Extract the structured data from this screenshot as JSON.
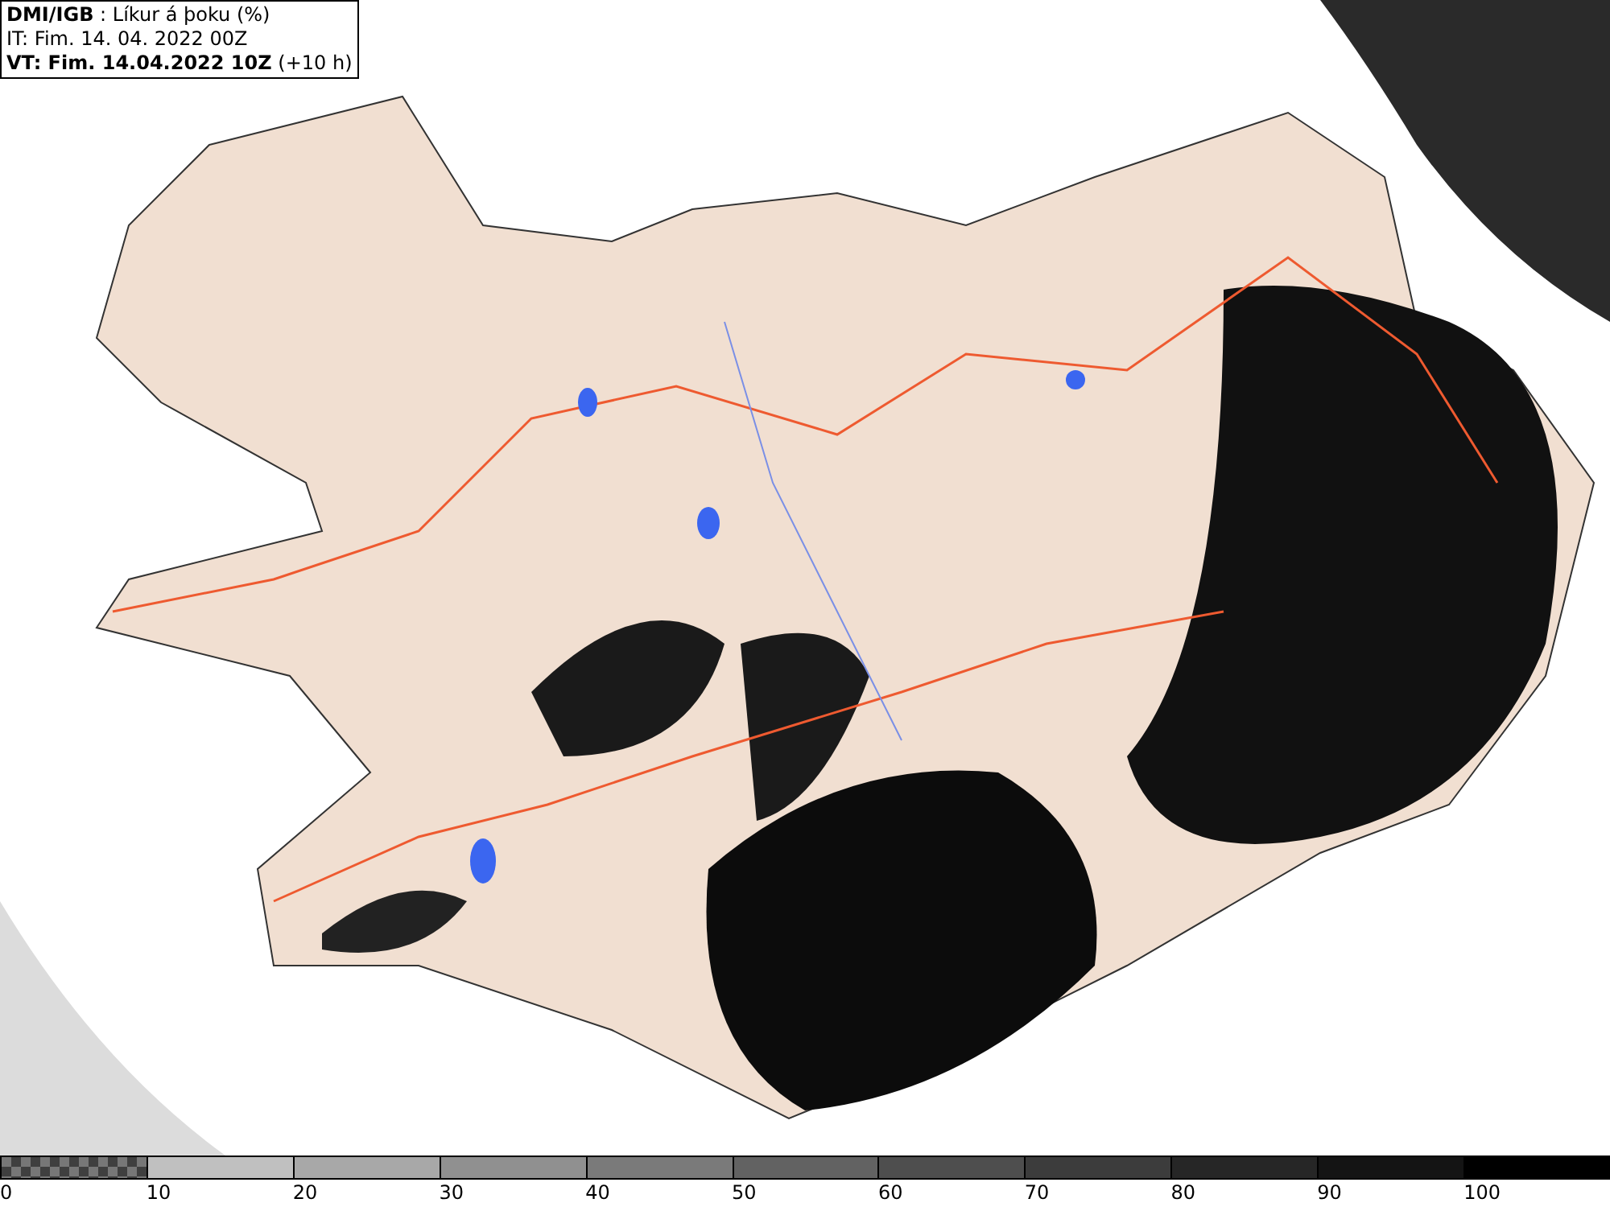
{
  "header": {
    "lines": [
      "**DMI/IGB** : Líkur á þoku (%)",
      "IT: Fim. 14. 04. 2022 00Z",
      "**VT: Fim. 14.04.2022 10Z** (+10 h)"
    ]
  },
  "legend": {
    "bins": [
      {
        "label": "0",
        "kind": "checker",
        "color": "#777777"
      },
      {
        "label": "10",
        "kind": "solid",
        "color": "#c0c0c0"
      },
      {
        "label": "20",
        "kind": "solid",
        "color": "#a8a8a8"
      },
      {
        "label": "30",
        "kind": "solid",
        "color": "#909090"
      },
      {
        "label": "40",
        "kind": "solid",
        "color": "#7a7a7a"
      },
      {
        "label": "50",
        "kind": "solid",
        "color": "#626262"
      },
      {
        "label": "60",
        "kind": "solid",
        "color": "#4e4e4e"
      },
      {
        "label": "70",
        "kind": "solid",
        "color": "#3c3c3c"
      },
      {
        "label": "80",
        "kind": "solid",
        "color": "#262626"
      },
      {
        "label": "90",
        "kind": "solid",
        "color": "#141414"
      },
      {
        "label": "100",
        "kind": "solid",
        "color": "#000000"
      }
    ]
  }
}
